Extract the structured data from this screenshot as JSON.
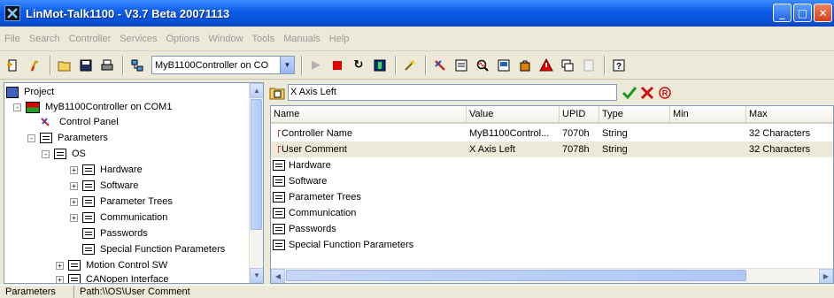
{
  "window": {
    "title": "LinMot-Talk1100 - V3.7 Beta 20071113"
  },
  "menu": [
    "File",
    "Search",
    "Controller",
    "Services",
    "Options",
    "Window",
    "Tools",
    "Manuals",
    "Help"
  ],
  "toolbar": {
    "controller_select": "MyB1100Controller on CO"
  },
  "tree": {
    "root": "Project",
    "controller": "MyB1100Controller on COM1",
    "control_panel": "Control Panel",
    "parameters": "Parameters",
    "os": "OS",
    "hardware": "Hardware",
    "software": "Software",
    "parameter_trees": "Parameter Trees",
    "communication": "Communication",
    "passwords": "Passwords",
    "special_function_parameters": "Special Function Parameters",
    "motion_control_sw": "Motion Control SW",
    "canopen_interface": "CANopen Interface"
  },
  "editor": {
    "value": "X Axis Left"
  },
  "grid": {
    "columns": [
      "Name",
      "Value",
      "UPID",
      "Type",
      "Min",
      "Max"
    ],
    "params": [
      {
        "name": "Controller Name",
        "value": "MyB1100Control...",
        "upid": "7070h",
        "type": "String",
        "min": "",
        "max": "32 Characters"
      },
      {
        "name": "User Comment",
        "value": "X Axis Left",
        "upid": "7078h",
        "type": "String",
        "min": "",
        "max": "32 Characters"
      }
    ],
    "folders": [
      "Hardware",
      "Software",
      "Parameter Trees",
      "Communication",
      "Passwords",
      "Special Function Parameters"
    ]
  },
  "status": {
    "left": "Parameters",
    "path": "Path:\\\\OS\\User Comment"
  },
  "colors": {
    "title_bar": "#0a5ae8",
    "selected_row": "#ece9d8",
    "apply_check": "#1a9a1a",
    "cancel_x": "#d01010"
  }
}
